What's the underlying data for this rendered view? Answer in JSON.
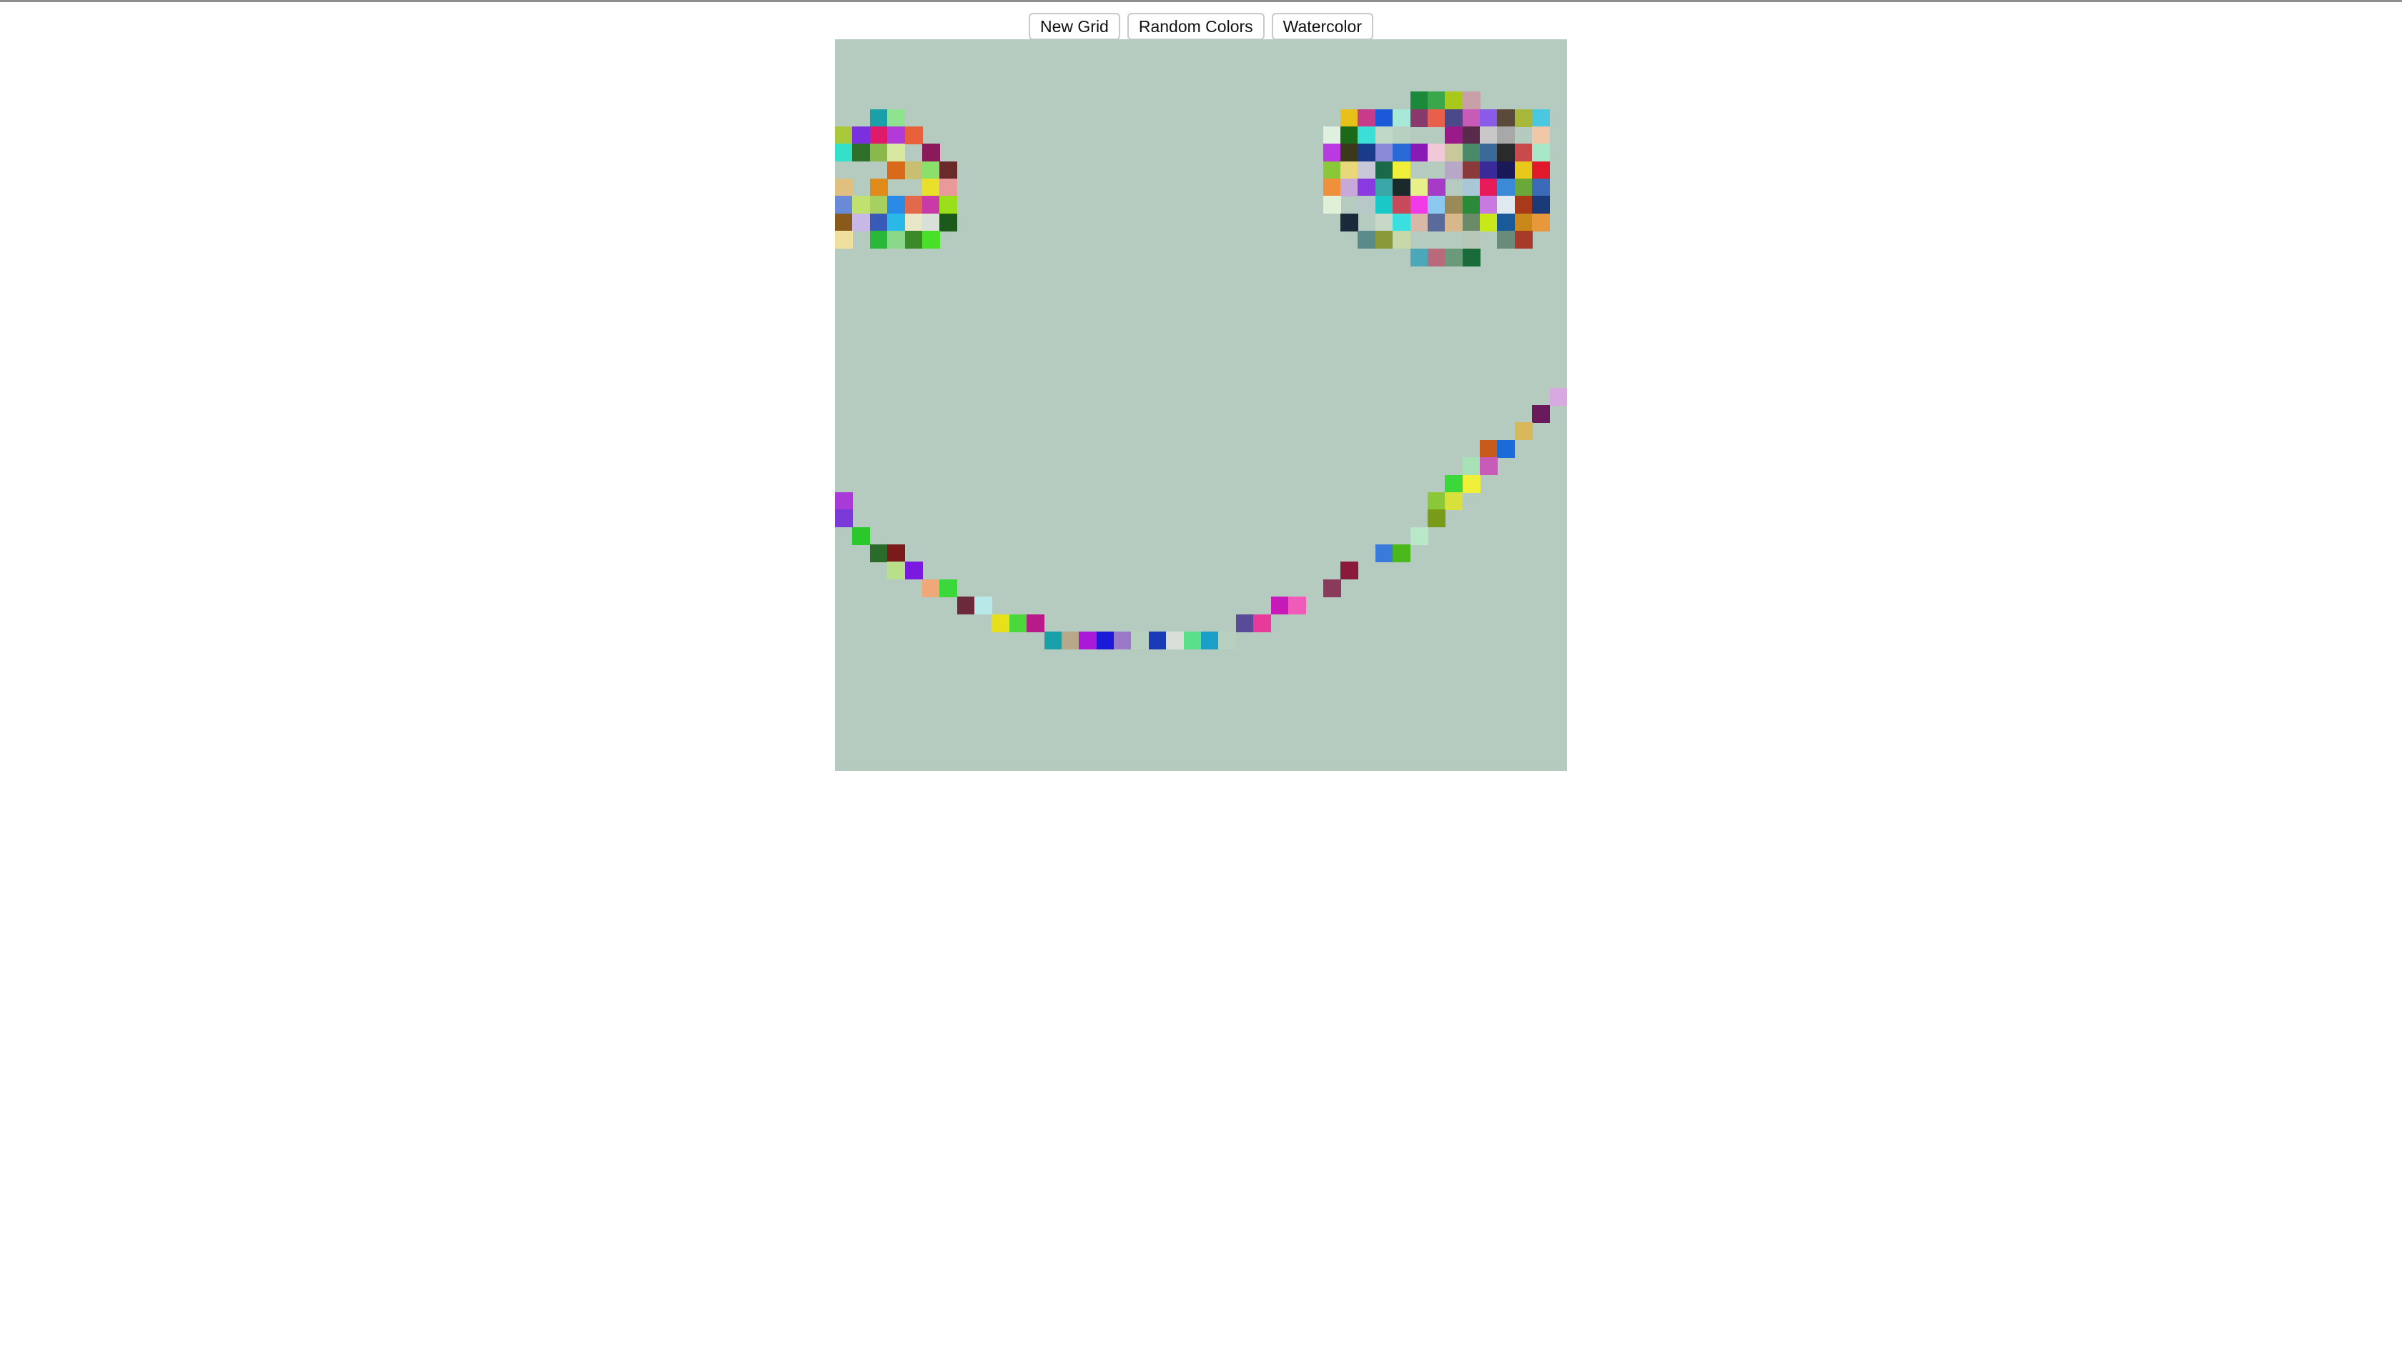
{
  "toolbar": {
    "new_grid_label": "New Grid",
    "random_colors_label": "Random Colors",
    "watercolor_label": "Watercolor"
  },
  "grid": {
    "columns": 42,
    "rows": 42,
    "background_color": "#b5cbbf",
    "painted_cells": [
      {
        "r": 4,
        "c": 2,
        "color": "#1aa0a8"
      },
      {
        "r": 4,
        "c": 3,
        "color": "#8fe28f"
      },
      {
        "r": 5,
        "c": 0,
        "color": "#a9c93a"
      },
      {
        "r": 5,
        "c": 1,
        "color": "#7a2fe0"
      },
      {
        "r": 5,
        "c": 2,
        "color": "#e01a6a"
      },
      {
        "r": 5,
        "c": 3,
        "color": "#b13ad8"
      },
      {
        "r": 5,
        "c": 4,
        "color": "#e8603a"
      },
      {
        "r": 6,
        "c": 0,
        "color": "#35e0c8"
      },
      {
        "r": 6,
        "c": 1,
        "color": "#2f6f2a"
      },
      {
        "r": 6,
        "c": 2,
        "color": "#8ab84a"
      },
      {
        "r": 6,
        "c": 3,
        "color": "#d8e8a0"
      },
      {
        "r": 6,
        "c": 5,
        "color": "#8a1a5a"
      },
      {
        "r": 7,
        "c": 3,
        "color": "#d86a1a"
      },
      {
        "r": 7,
        "c": 4,
        "color": "#c8c070"
      },
      {
        "r": 7,
        "c": 5,
        "color": "#8ae06a"
      },
      {
        "r": 7,
        "c": 6,
        "color": "#6a2a2a"
      },
      {
        "r": 8,
        "c": 0,
        "color": "#e0c080"
      },
      {
        "r": 8,
        "c": 2,
        "color": "#e08a1a"
      },
      {
        "r": 8,
        "c": 5,
        "color": "#e8e02a"
      },
      {
        "r": 8,
        "c": 6,
        "color": "#e89a9a"
      },
      {
        "r": 9,
        "c": 0,
        "color": "#6a8ad8"
      },
      {
        "r": 9,
        "c": 1,
        "color": "#c0e070"
      },
      {
        "r": 9,
        "c": 2,
        "color": "#a8d060"
      },
      {
        "r": 9,
        "c": 3,
        "color": "#2a8ae8"
      },
      {
        "r": 9,
        "c": 4,
        "color": "#e06a4a"
      },
      {
        "r": 9,
        "c": 5,
        "color": "#c83aa8"
      },
      {
        "r": 9,
        "c": 6,
        "color": "#9ae01a"
      },
      {
        "r": 10,
        "c": 0,
        "color": "#8a5a1a"
      },
      {
        "r": 10,
        "c": 1,
        "color": "#c8b8e8"
      },
      {
        "r": 10,
        "c": 2,
        "color": "#3a5ab8"
      },
      {
        "r": 10,
        "c": 3,
        "color": "#2ab8e8"
      },
      {
        "r": 10,
        "c": 4,
        "color": "#e8e8c8"
      },
      {
        "r": 10,
        "c": 5,
        "color": "#d8e0d8"
      },
      {
        "r": 10,
        "c": 6,
        "color": "#1a5a1a"
      },
      {
        "r": 11,
        "c": 0,
        "color": "#f0e0a0"
      },
      {
        "r": 11,
        "c": 2,
        "color": "#2ab83a"
      },
      {
        "r": 11,
        "c": 3,
        "color": "#8ad88a"
      },
      {
        "r": 11,
        "c": 4,
        "color": "#3a8a2a"
      },
      {
        "r": 11,
        "c": 5,
        "color": "#4ae02a"
      },
      {
        "r": 3,
        "c": 33,
        "color": "#1a8a3a"
      },
      {
        "r": 3,
        "c": 34,
        "color": "#3aa84a"
      },
      {
        "r": 3,
        "c": 35,
        "color": "#a8c81a"
      },
      {
        "r": 3,
        "c": 36,
        "color": "#c8a0a8"
      },
      {
        "r": 4,
        "c": 29,
        "color": "#e8c01a"
      },
      {
        "r": 4,
        "c": 30,
        "color": "#c83a8a"
      },
      {
        "r": 4,
        "c": 31,
        "color": "#1a5ad8"
      },
      {
        "r": 4,
        "c": 32,
        "color": "#a8e8d8"
      },
      {
        "r": 4,
        "c": 33,
        "color": "#8a3a6a"
      },
      {
        "r": 4,
        "c": 34,
        "color": "#e8604a"
      },
      {
        "r": 4,
        "c": 35,
        "color": "#4a4a8a"
      },
      {
        "r": 4,
        "c": 36,
        "color": "#c85ab8"
      },
      {
        "r": 4,
        "c": 37,
        "color": "#8a5ae8"
      },
      {
        "r": 4,
        "c": 38,
        "color": "#5a4a3a"
      },
      {
        "r": 4,
        "c": 39,
        "color": "#a8b83a"
      },
      {
        "r": 4,
        "c": 40,
        "color": "#4ac8e0"
      },
      {
        "r": 5,
        "c": 28,
        "color": "#e0f0e0"
      },
      {
        "r": 5,
        "c": 29,
        "color": "#1a6a1a"
      },
      {
        "r": 5,
        "c": 30,
        "color": "#3ae0d8"
      },
      {
        "r": 5,
        "c": 31,
        "color": "#c0d8c8"
      },
      {
        "r": 5,
        "c": 32,
        "color": "#b8d0c0"
      },
      {
        "r": 5,
        "c": 35,
        "color": "#9a1a8a"
      },
      {
        "r": 5,
        "c": 36,
        "color": "#5a2a4a"
      },
      {
        "r": 5,
        "c": 37,
        "color": "#c8c8c8"
      },
      {
        "r": 5,
        "c": 38,
        "color": "#a8a8a8"
      },
      {
        "r": 5,
        "c": 40,
        "color": "#f0c8a8"
      },
      {
        "r": 6,
        "c": 28,
        "color": "#b83ae0"
      },
      {
        "r": 6,
        "c": 29,
        "color": "#3a3a1a"
      },
      {
        "r": 6,
        "c": 30,
        "color": "#1a3a8a"
      },
      {
        "r": 6,
        "c": 31,
        "color": "#8a8ad8"
      },
      {
        "r": 6,
        "c": 32,
        "color": "#2a6ad8"
      },
      {
        "r": 6,
        "c": 33,
        "color": "#8a1ab8"
      },
      {
        "r": 6,
        "c": 34,
        "color": "#f0c8d8"
      },
      {
        "r": 6,
        "c": 35,
        "color": "#c8c89a"
      },
      {
        "r": 6,
        "c": 36,
        "color": "#4a8a6a"
      },
      {
        "r": 6,
        "c": 37,
        "color": "#3a6a9a"
      },
      {
        "r": 6,
        "c": 38,
        "color": "#2a2a2a"
      },
      {
        "r": 6,
        "c": 39,
        "color": "#c84a4a"
      },
      {
        "r": 6,
        "c": 40,
        "color": "#a8e8c8"
      },
      {
        "r": 7,
        "c": 28,
        "color": "#8ac83a"
      },
      {
        "r": 7,
        "c": 29,
        "color": "#e8d87a"
      },
      {
        "r": 7,
        "c": 30,
        "color": "#c8c8d8"
      },
      {
        "r": 7,
        "c": 31,
        "color": "#1a6a4a"
      },
      {
        "r": 7,
        "c": 32,
        "color": "#f0f03a"
      },
      {
        "r": 7,
        "c": 35,
        "color": "#b8a8c8"
      },
      {
        "r": 7,
        "c": 36,
        "color": "#8a3a3a"
      },
      {
        "r": 7,
        "c": 37,
        "color": "#3a2a9a"
      },
      {
        "r": 7,
        "c": 38,
        "color": "#1a1a5a"
      },
      {
        "r": 7,
        "c": 39,
        "color": "#e8c81a"
      },
      {
        "r": 7,
        "c": 40,
        "color": "#e01a2a"
      },
      {
        "r": 8,
        "c": 28,
        "color": "#f0903a"
      },
      {
        "r": 8,
        "c": 29,
        "color": "#c8a8d8"
      },
      {
        "r": 8,
        "c": 30,
        "color": "#8a3ae0"
      },
      {
        "r": 8,
        "c": 31,
        "color": "#3aa8a8"
      },
      {
        "r": 8,
        "c": 32,
        "color": "#1a2a2a"
      },
      {
        "r": 8,
        "c": 33,
        "color": "#e8f08a"
      },
      {
        "r": 8,
        "c": 34,
        "color": "#a83ac8"
      },
      {
        "r": 8,
        "c": 36,
        "color": "#a8c8d8"
      },
      {
        "r": 8,
        "c": 37,
        "color": "#e81a5a"
      },
      {
        "r": 8,
        "c": 38,
        "color": "#3a8ad8"
      },
      {
        "r": 8,
        "c": 39,
        "color": "#6aa83a"
      },
      {
        "r": 8,
        "c": 40,
        "color": "#3a6ab8"
      },
      {
        "r": 9,
        "c": 28,
        "color": "#e0f0d8"
      },
      {
        "r": 9,
        "c": 30,
        "color": "#b8c8c8"
      },
      {
        "r": 9,
        "c": 31,
        "color": "#1ac8c8"
      },
      {
        "r": 9,
        "c": 32,
        "color": "#c84a5a"
      },
      {
        "r": 9,
        "c": 33,
        "color": "#f03ae8"
      },
      {
        "r": 9,
        "c": 34,
        "color": "#8ac8f0"
      },
      {
        "r": 9,
        "c": 35,
        "color": "#9a8a5a"
      },
      {
        "r": 9,
        "c": 36,
        "color": "#2a8a3a"
      },
      {
        "r": 9,
        "c": 37,
        "color": "#c87ae0"
      },
      {
        "r": 9,
        "c": 38,
        "color": "#e0e8f0"
      },
      {
        "r": 9,
        "c": 39,
        "color": "#a83a1a"
      },
      {
        "r": 9,
        "c": 40,
        "color": "#1a3a7a"
      },
      {
        "r": 10,
        "c": 29,
        "color": "#1a2a3a"
      },
      {
        "r": 10,
        "c": 31,
        "color": "#c8d8c8"
      },
      {
        "r": 10,
        "c": 32,
        "color": "#3ae0e0"
      },
      {
        "r": 10,
        "c": 33,
        "color": "#d8b8a8"
      },
      {
        "r": 10,
        "c": 34,
        "color": "#5a6a9a"
      },
      {
        "r": 10,
        "c": 35,
        "color": "#d8b88a"
      },
      {
        "r": 10,
        "c": 36,
        "color": "#6a8a6a"
      },
      {
        "r": 10,
        "c": 37,
        "color": "#c8e81a"
      },
      {
        "r": 10,
        "c": 38,
        "color": "#1a5a9a"
      },
      {
        "r": 10,
        "c": 39,
        "color": "#c8881a"
      },
      {
        "r": 10,
        "c": 40,
        "color": "#e8983a"
      },
      {
        "r": 11,
        "c": 30,
        "color": "#5a8a8a"
      },
      {
        "r": 11,
        "c": 31,
        "color": "#8a9a3a"
      },
      {
        "r": 11,
        "c": 32,
        "color": "#c8d8a8"
      },
      {
        "r": 11,
        "c": 36,
        "color": "#b8c8b8"
      },
      {
        "r": 11,
        "c": 38,
        "color": "#6a8a7a"
      },
      {
        "r": 11,
        "c": 39,
        "color": "#a83a2a"
      },
      {
        "r": 12,
        "c": 33,
        "color": "#4aa8b8"
      },
      {
        "r": 12,
        "c": 34,
        "color": "#b86a7a"
      },
      {
        "r": 12,
        "c": 35,
        "color": "#6a9a7a"
      },
      {
        "r": 12,
        "c": 36,
        "color": "#1a6a3a"
      },
      {
        "r": 20,
        "c": 41,
        "color": "#d8a8e0"
      },
      {
        "r": 21,
        "c": 40,
        "color": "#6a1a5a"
      },
      {
        "r": 22,
        "c": 39,
        "color": "#d8b85a"
      },
      {
        "r": 23,
        "c": 37,
        "color": "#c85a1a"
      },
      {
        "r": 23,
        "c": 38,
        "color": "#1a6ad8"
      },
      {
        "r": 24,
        "c": 36,
        "color": "#a8e0b8"
      },
      {
        "r": 24,
        "c": 37,
        "color": "#c85ab8"
      },
      {
        "r": 25,
        "c": 35,
        "color": "#3ad83a"
      },
      {
        "r": 25,
        "c": 36,
        "color": "#f0f03a"
      },
      {
        "r": 26,
        "c": 34,
        "color": "#8ac83a"
      },
      {
        "r": 26,
        "c": 35,
        "color": "#d8e03a"
      },
      {
        "r": 27,
        "c": 34,
        "color": "#7a9a1a"
      },
      {
        "r": 28,
        "c": 33,
        "color": "#b8e8c8"
      },
      {
        "r": 29,
        "c": 31,
        "color": "#3a7ad8"
      },
      {
        "r": 29,
        "c": 32,
        "color": "#4ab81a"
      },
      {
        "r": 30,
        "c": 29,
        "color": "#8a1a3a"
      },
      {
        "r": 31,
        "c": 28,
        "color": "#8a3a5a"
      },
      {
        "r": 32,
        "c": 25,
        "color": "#c81ab8"
      },
      {
        "r": 32,
        "c": 26,
        "color": "#f05ab8"
      },
      {
        "r": 33,
        "c": 23,
        "color": "#5a4a9a"
      },
      {
        "r": 33,
        "c": 24,
        "color": "#e83a9a"
      },
      {
        "r": 26,
        "c": 0,
        "color": "#a83ad8"
      },
      {
        "r": 27,
        "c": 0,
        "color": "#7a3ad8"
      },
      {
        "r": 28,
        "c": 1,
        "color": "#2ac82a"
      },
      {
        "r": 29,
        "c": 2,
        "color": "#2a6a2a"
      },
      {
        "r": 29,
        "c": 3,
        "color": "#7a1a1a"
      },
      {
        "r": 30,
        "c": 3,
        "color": "#b8e08a"
      },
      {
        "r": 30,
        "c": 4,
        "color": "#7a1ae0"
      },
      {
        "r": 31,
        "c": 5,
        "color": "#f0a878"
      },
      {
        "r": 31,
        "c": 6,
        "color": "#3ad83a"
      },
      {
        "r": 32,
        "c": 7,
        "color": "#6a2a3a"
      },
      {
        "r": 32,
        "c": 8,
        "color": "#b8e8e8"
      },
      {
        "r": 33,
        "c": 9,
        "color": "#e8e01a"
      },
      {
        "r": 33,
        "c": 10,
        "color": "#4ad83a"
      },
      {
        "r": 33,
        "c": 11,
        "color": "#b81a8a"
      },
      {
        "r": 34,
        "c": 12,
        "color": "#1aa0a8"
      },
      {
        "r": 34,
        "c": 13,
        "color": "#b8a88a"
      },
      {
        "r": 34,
        "c": 14,
        "color": "#a81ad8"
      },
      {
        "r": 34,
        "c": 15,
        "color": "#1a1ad8"
      },
      {
        "r": 34,
        "c": 16,
        "color": "#9a7ac8"
      },
      {
        "r": 34,
        "c": 17,
        "color": "#b8d0c0"
      },
      {
        "r": 34,
        "c": 18,
        "color": "#1a3ab8"
      },
      {
        "r": 34,
        "c": 19,
        "color": "#d8e0d8"
      },
      {
        "r": 34,
        "c": 20,
        "color": "#5ae08a"
      },
      {
        "r": 34,
        "c": 21,
        "color": "#1aa0c8"
      },
      {
        "r": 34,
        "c": 22,
        "color": "#b8d0c0"
      }
    ]
  }
}
